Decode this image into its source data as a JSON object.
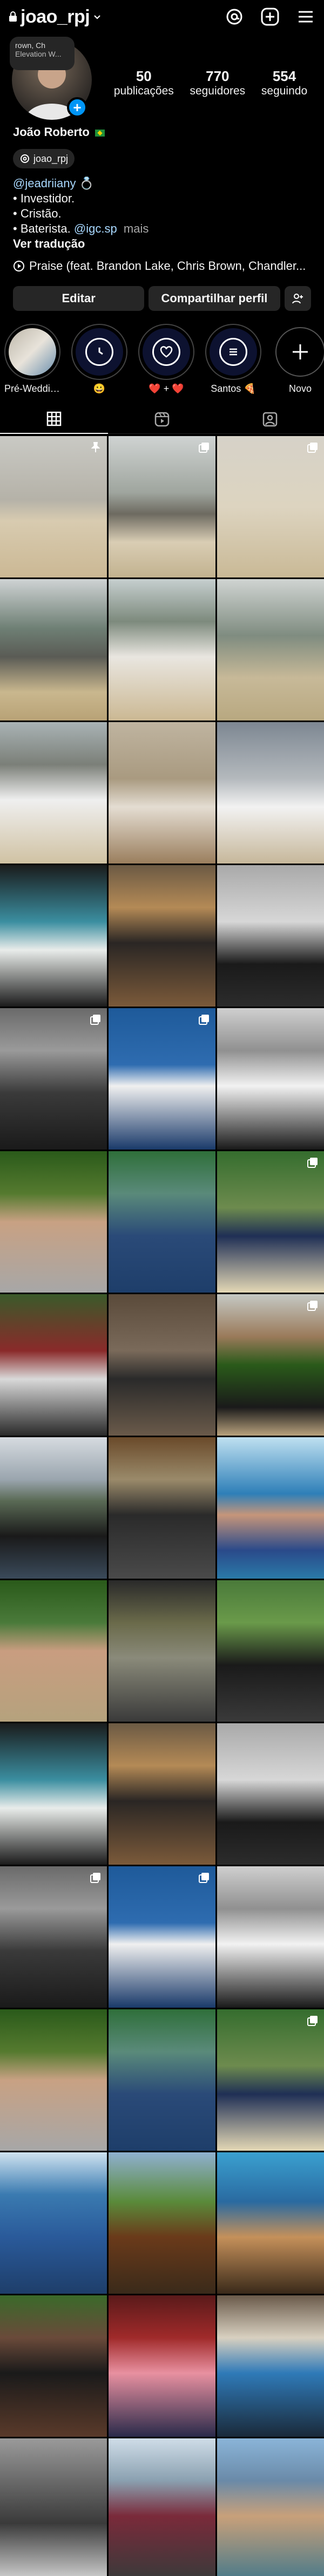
{
  "topbar": {
    "username": "joao_rpj",
    "icons": [
      "lock-icon",
      "chevron-down-icon",
      "threads-icon",
      "add-post-icon",
      "menu-icon"
    ]
  },
  "note": {
    "line1": "rown, Ch",
    "line2": "Elevation W..."
  },
  "stats": [
    {
      "num": "50",
      "label": "publicações"
    },
    {
      "num": "770",
      "label": "seguidores"
    },
    {
      "num": "554",
      "label": "seguindo"
    }
  ],
  "profile": {
    "name": "João Roberto",
    "threads_handle": "joao_rpj",
    "bio_mention": "@jeadriiany",
    "bio_lines": [
      "• Investidor.",
      "• Cristão.",
      "• Baterista."
    ],
    "bio_link": "@igc.sp",
    "bio_more": "mais",
    "translation": "Ver tradução",
    "music": "Praise (feat. Brandon Lake, Chris Brown, Chandler..."
  },
  "buttons": {
    "edit": "Editar",
    "share": "Compartilhar perfil"
  },
  "highlights": [
    {
      "label": "Pré-Weddin...",
      "kind": "photo"
    },
    {
      "label": "😀",
      "kind": "icon"
    },
    {
      "label": "❤️ + ❤️",
      "kind": "icon"
    },
    {
      "label": "Santos 🍕",
      "kind": "icon"
    },
    {
      "label": "Novo",
      "kind": "new"
    }
  ],
  "tabs": [
    "grid-tab",
    "reels-tab",
    "tagged-tab"
  ],
  "colors": {
    "accent": "#0095f6",
    "background": "#000000",
    "button": "#262626"
  }
}
